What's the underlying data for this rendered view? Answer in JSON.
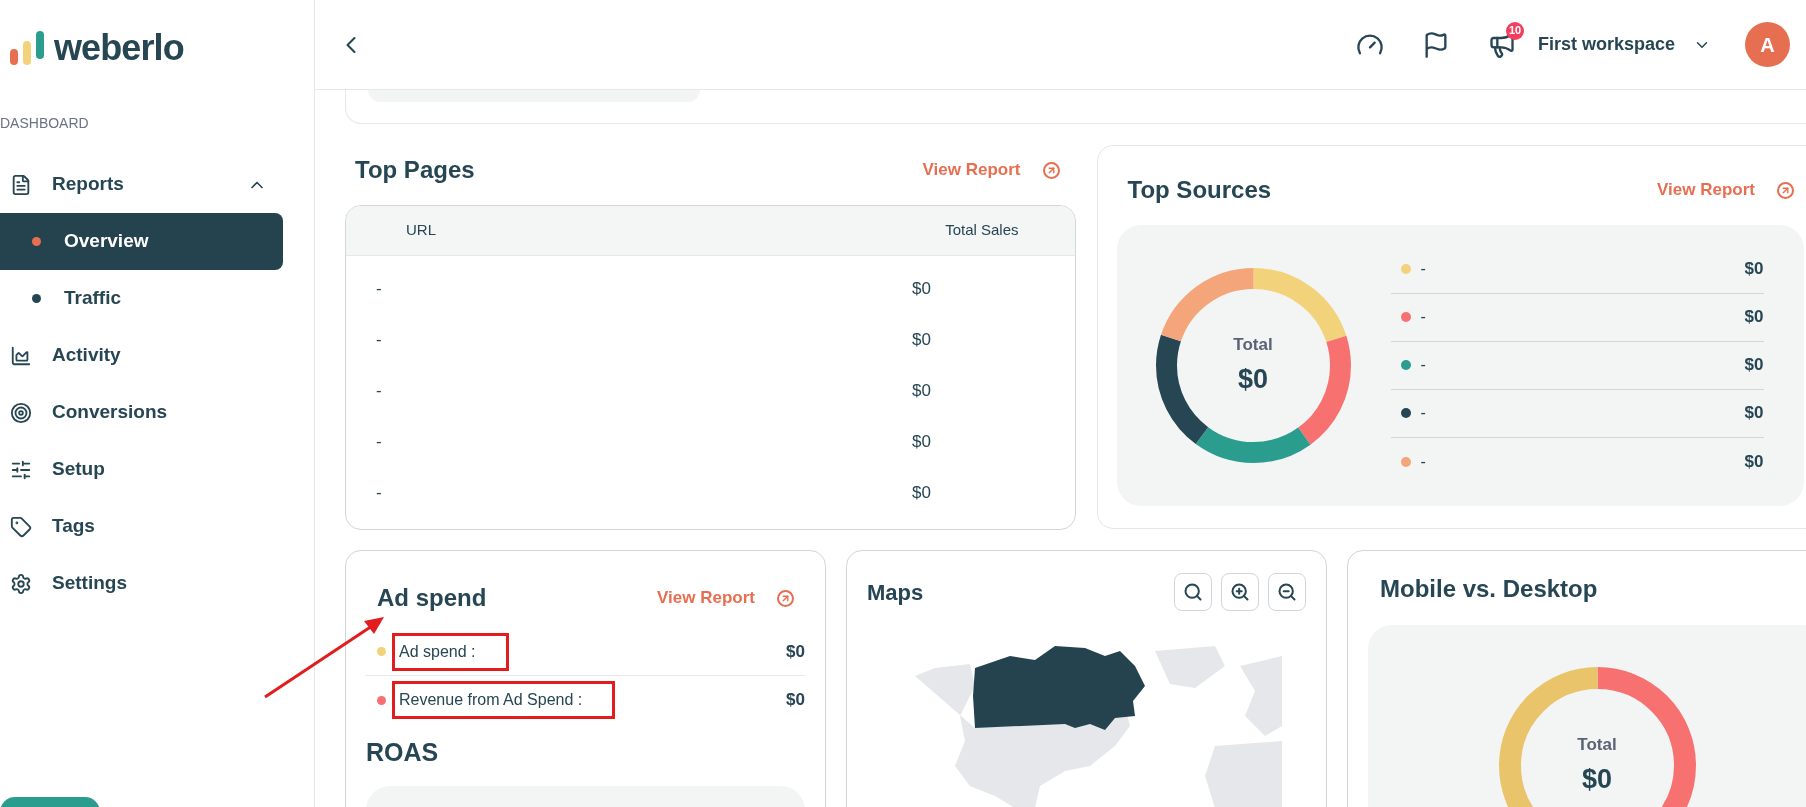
{
  "sidebar": {
    "logo": "weberlo",
    "section_label": "DASHBOARD",
    "items": [
      {
        "label": "Reports",
        "kind": "group",
        "expanded": true,
        "children": [
          {
            "label": "Overview",
            "selected": true
          },
          {
            "label": "Traffic",
            "selected": false
          }
        ]
      },
      {
        "label": "Activity",
        "kind": "link"
      },
      {
        "label": "Conversions",
        "kind": "link"
      },
      {
        "label": "Setup",
        "kind": "link"
      },
      {
        "label": "Tags",
        "kind": "link"
      },
      {
        "label": "Settings",
        "kind": "link"
      }
    ]
  },
  "header": {
    "notification_count": "10",
    "workspace": "First workspace",
    "avatar_initial": "A"
  },
  "top_pages": {
    "title": "Top Pages",
    "link": "View Report",
    "columns": [
      "URL",
      "Total Sales"
    ],
    "rows": [
      {
        "url": "-",
        "total_sales": "$0"
      },
      {
        "url": "-",
        "total_sales": "$0"
      },
      {
        "url": "-",
        "total_sales": "$0"
      },
      {
        "url": "-",
        "total_sales": "$0"
      },
      {
        "url": "-",
        "total_sales": "$0"
      }
    ]
  },
  "top_sources": {
    "title": "Top Sources",
    "link": "View Report",
    "total_label": "Total",
    "total_value": "$0",
    "legend": [
      {
        "label": "-",
        "value": "$0",
        "color": "#f2d27a"
      },
      {
        "label": "-",
        "value": "$0",
        "color": "#f87171"
      },
      {
        "label": "-",
        "value": "$0",
        "color": "#2a9d8f"
      },
      {
        "label": "-",
        "value": "$0",
        "color": "#264653"
      },
      {
        "label": "-",
        "value": "$0",
        "color": "#f4a67a"
      }
    ]
  },
  "ad_spend": {
    "title": "Ad spend",
    "link": "View Report",
    "items": [
      {
        "label": "Ad spend :",
        "value": "$0",
        "color": "#f2d27a",
        "highlighted": true
      },
      {
        "label": "Revenue from Ad Spend :",
        "value": "$0",
        "color": "#f87171",
        "highlighted": true
      }
    ],
    "roas_title": "ROAS"
  },
  "maps": {
    "title": "Maps"
  },
  "mobile_desktop": {
    "title": "Mobile vs. Desktop",
    "total_label": "Total",
    "total_value": "$0"
  }
}
